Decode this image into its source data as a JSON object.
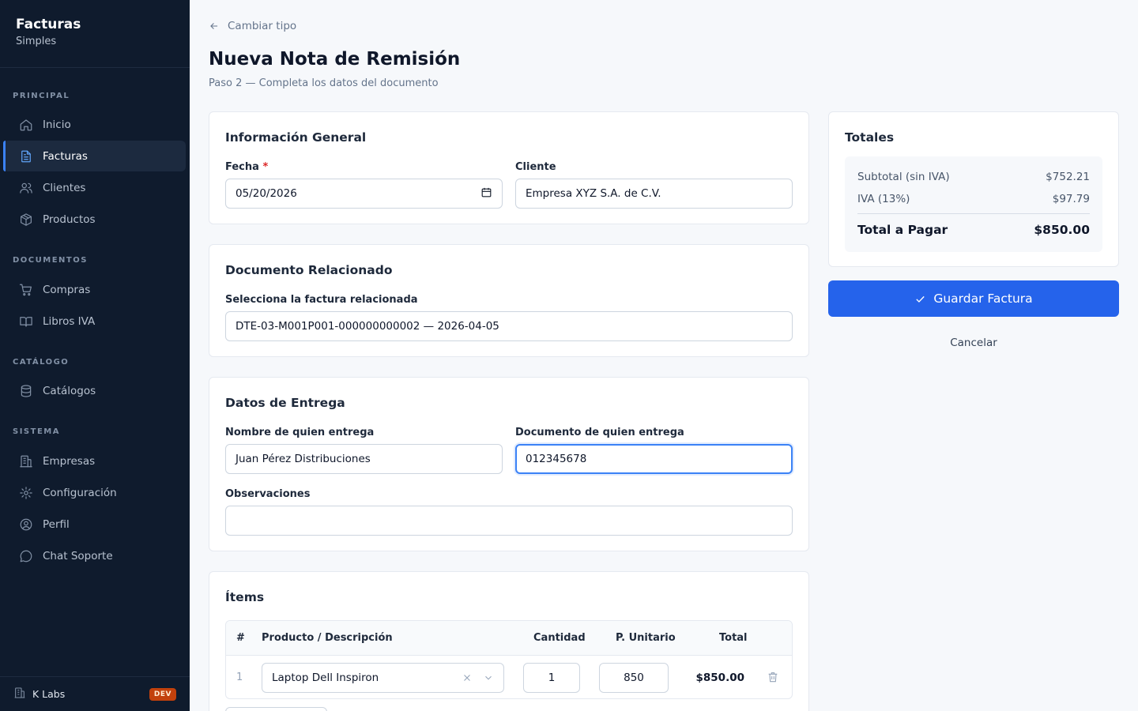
{
  "sidebar": {
    "brand_title": "Facturas",
    "brand_sub": "Simples",
    "sections": {
      "principal": "PRINCIPAL",
      "documentos": "DOCUMENTOS",
      "catalogo": "CATÁLOGO",
      "sistema": "SISTEMA"
    },
    "items": {
      "inicio": "Inicio",
      "facturas": "Facturas",
      "clientes": "Clientes",
      "productos": "Productos",
      "compras": "Compras",
      "libros": "Libros IVA",
      "catalogos": "Catálogos",
      "empresas": "Empresas",
      "configuracion": "Configuración",
      "perfil": "Perfil",
      "chat": "Chat Soporte"
    },
    "active": "facturas",
    "footer": {
      "org": "K Labs",
      "badge": "DEV"
    }
  },
  "header": {
    "back_label": "Cambiar tipo",
    "title": "Nueva Nota de Remisión",
    "subtitle": "Paso 2 — Completa los datos del documento"
  },
  "general": {
    "title": "Información General",
    "fecha_label": "Fecha",
    "fecha_required": "*",
    "fecha_value": "05/20/2026",
    "cliente_label": "Cliente",
    "cliente_value": "Empresa XYZ S.A. de C.V."
  },
  "related": {
    "title": "Documento Relacionado",
    "label": "Selecciona la factura relacionada",
    "value": "DTE-03-M001P001-000000000002 — 2026-04-05"
  },
  "delivery": {
    "title": "Datos de Entrega",
    "name_label": "Nombre de quien entrega",
    "name_value": "Juan Pérez Distribuciones",
    "doc_label": "Documento de quien entrega",
    "doc_value": "012345678",
    "obs_label": "Observaciones",
    "obs_value": ""
  },
  "items": {
    "title": "Ítems",
    "columns": {
      "num": "#",
      "product": "Producto / Descripción",
      "qty": "Cantidad",
      "unit": "P. Unitario",
      "total": "Total"
    },
    "rows": [
      {
        "num": "1",
        "product": "Laptop Dell Inspiron",
        "qty": "1",
        "unit": "850",
        "total": "$850.00"
      }
    ]
  },
  "totals": {
    "title": "Totales",
    "subtotal_label": "Subtotal (sin IVA)",
    "subtotal_value": "$752.21",
    "iva_label": "IVA (13%)",
    "iva_value": "$97.79",
    "total_label": "Total a Pagar",
    "total_value": "$850.00"
  },
  "actions": {
    "save_label": "Guardar Factura",
    "cancel_label": "Cancelar"
  },
  "colors": {
    "sidebar_bg": "#0f1b2d",
    "accent": "#2563eb",
    "focus": "#3b82f6",
    "dev_badge": "#c2410c"
  }
}
